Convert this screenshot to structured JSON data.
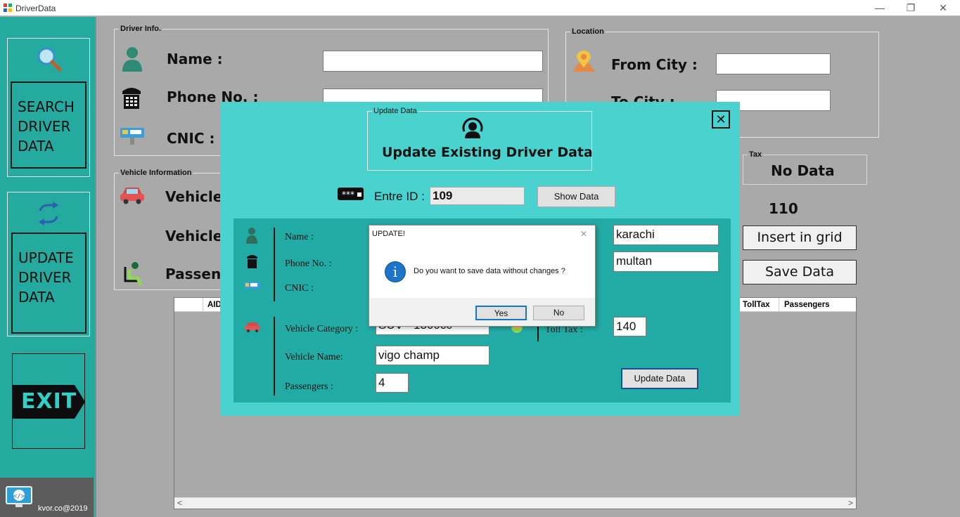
{
  "window": {
    "title": "DriverData",
    "minimize": "—",
    "restore": "❐",
    "close": "✕"
  },
  "sidebar": {
    "search_label": "SEARCH DRIVER DATA",
    "update_label": "UPDATE DRIVER DATA",
    "exit_label": "EXIT",
    "footer_text": "kvor.co@2019"
  },
  "driver_info": {
    "legend": "Driver Info.",
    "name_label": "Name :",
    "phone_label": "Phone No. :",
    "cnic_label": "CNIC :",
    "name_value": "",
    "phone_value": ""
  },
  "location": {
    "legend": "Location",
    "from_label": "From City :",
    "to_label": "To City :",
    "from_value": "",
    "to_value": ""
  },
  "vehicle_info": {
    "legend": "Vehicle Information",
    "category_label": "Vehicle",
    "name_label": "Vehicle",
    "passengers_label": "Passeng"
  },
  "tax": {
    "legend": "Tax",
    "value": "No Data",
    "id_value": "110"
  },
  "actions": {
    "insert_grid": "Insert in grid",
    "save_data": "Save Data"
  },
  "grid": {
    "columns": [
      "AID",
      "TollTax",
      "Passengers"
    ],
    "scroll_left": "<",
    "scroll_right": ">"
  },
  "modal": {
    "legend": "Update Data",
    "heading": "Update Existing Driver Data",
    "close": "✕",
    "enter_id_label": "Entre ID :",
    "id_value": "109",
    "show_button": "Show Data",
    "name_label": "Name :",
    "phone_label": "Phone No. :",
    "cnic_label": "CNIC :",
    "from_value": "karachi",
    "to_value": "multan",
    "category_label": "Vehicle Category :",
    "category_value": "SUV  -  1300cc",
    "vehicle_name_label": "Vehicle Name:",
    "vehicle_name_value": "vigo champ",
    "passengers_label": "Passengers :",
    "passengers_value": "4",
    "toll_label": "Toll Tax :",
    "toll_value": "140",
    "update_button": "Update Data"
  },
  "dialog": {
    "title": "UPDATE!",
    "close": "✕",
    "message": "Do you want to save data without changes ?",
    "info_glyph": "i",
    "yes": "Yes",
    "no": "No"
  },
  "colors": {
    "teal": "#25aaa0",
    "modal_teal": "#4ad2ce",
    "inner_teal": "#22aba5",
    "info_blue": "#1c75c8"
  }
}
